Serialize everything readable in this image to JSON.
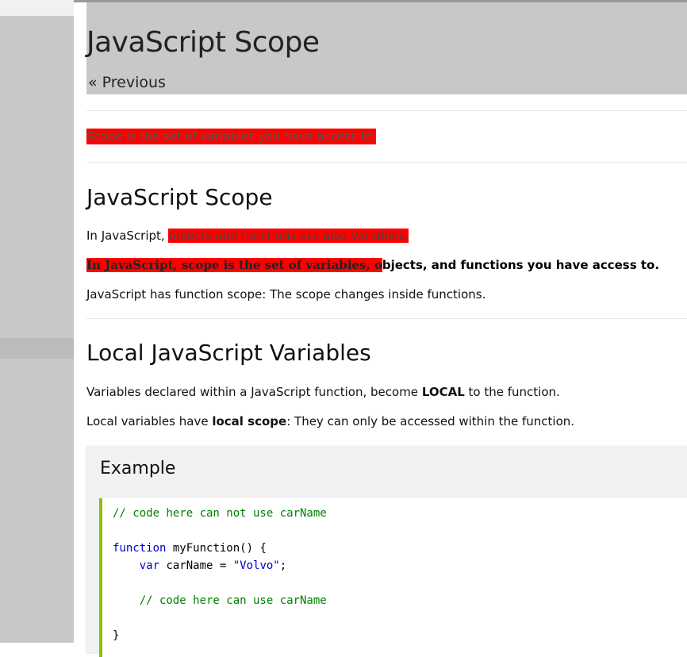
{
  "header": {
    "title": "JavaScript Scope",
    "previous_label": "« Previous"
  },
  "intro": "Scope is the set of variables you have access to.",
  "section_scope": {
    "heading": "JavaScript Scope",
    "p1_prefix": "In JavaScript, ",
    "p1_highlight": "objects and functions are also variables.",
    "p2_highlight": "In JavaScript, scope is the set of variables, o",
    "p2_rest": "bjects, and functions you have access to.",
    "p3": "JavaScript has function scope: The scope changes inside functions."
  },
  "section_local": {
    "heading": "Local JavaScript Variables",
    "p1_prefix": "Variables declared within a JavaScript function, become ",
    "p1_bold": "LOCAL",
    "p1_suffix": " to the function.",
    "p2_prefix": "Local variables have ",
    "p2_bold": "local scope",
    "p2_suffix": ": They can only be accessed within the function."
  },
  "example": {
    "title": "Example",
    "code": {
      "line1": "// code here can not use carName",
      "line2_kw": "function",
      "line2_rest": " myFunction() {",
      "line3_indent": "    ",
      "line3_kw": "var",
      "line3_mid": " carName = ",
      "line3_str": "\"Volvo\"",
      "line3_end": ";",
      "line4": "    // code here can use carName",
      "line5": "}"
    }
  },
  "colors": {
    "highlight": "#ff0000",
    "code_border": "#8ac007",
    "comment": "#008000",
    "keyword": "#0000cd"
  }
}
